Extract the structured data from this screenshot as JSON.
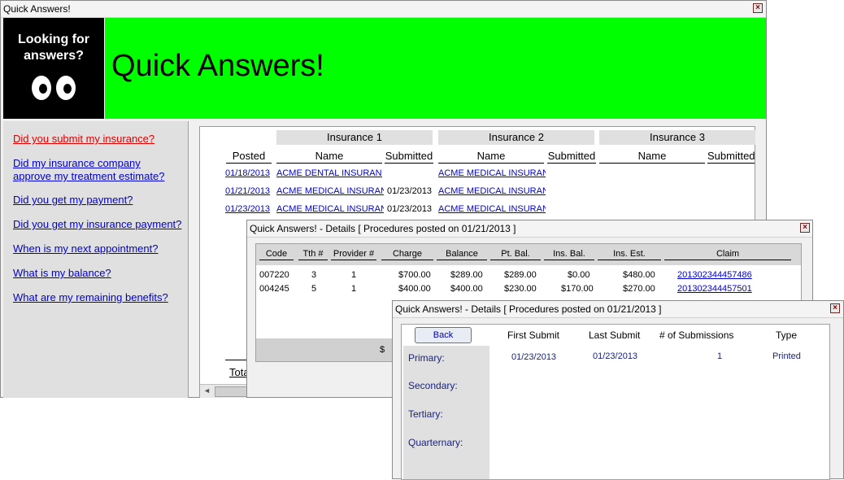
{
  "main": {
    "title": "Quick Answers!",
    "logo_line1": "Looking for",
    "logo_line2": "answers?",
    "banner_title": "Quick Answers!",
    "questions": [
      "Did you submit my insurance?",
      "Did my insurance company ",
      "approve my treatment estimate?",
      "Did you get my payment?",
      "Did you get my insurance payment?",
      "When is my next appointment?",
      "What is my balance?",
      "What are my remaining benefits?"
    ],
    "groups": [
      "Insurance 1",
      "Insurance 2",
      "Insurance 3"
    ],
    "col_posted": "Posted",
    "col_name": "Name",
    "col_submitted": "Submitted",
    "rows": [
      {
        "posted": "01/18/2013",
        "ins1": "ACME DENTAL INSURANCE",
        "sub1": "",
        "ins2": "ACME MEDICAL INSURANCE",
        "sub2": ""
      },
      {
        "posted": "01/21/2013",
        "ins1": "ACME MEDICAL INSURANCE",
        "sub1": "01/23/2013",
        "ins2": "ACME MEDICAL INSURANCE",
        "sub2": ""
      },
      {
        "posted": "01/23/2013",
        "ins1": "ACME MEDICAL INSURANCE",
        "sub1": "01/23/2013",
        "ins2": "ACME MEDICAL INSURANCE",
        "sub2": ""
      }
    ],
    "total_label": "Tota"
  },
  "details1": {
    "title": "Quick Answers! - Details [ Procedures posted on 01/21/2013 ]",
    "headers": [
      "Code",
      "Tth #",
      "Provider #",
      "Charge",
      "Balance",
      "Pt. Bal.",
      "Ins. Bal.",
      "Ins. Est.",
      "Claim"
    ],
    "rows": [
      [
        "007220",
        "3",
        "1",
        "$700.00",
        "$289.00",
        "$289.00",
        "$0.00",
        "$480.00",
        "201302344457486"
      ],
      [
        "004245",
        "5",
        "1",
        "$400.00",
        "$400.00",
        "$230.00",
        "$170.00",
        "$270.00",
        "201302344457501"
      ]
    ],
    "footer_fragment": "$"
  },
  "details2": {
    "title": "Quick Answers! - Details [ Procedures posted on 01/21/2013 ]",
    "back_label": "Back",
    "headers": [
      "First Submit",
      "Last Submit",
      "# of Submissions",
      "Type"
    ],
    "labels": [
      "Primary:",
      "Secondary:",
      "Tertiary:",
      "Quarternary:"
    ],
    "primary": {
      "first": "01/23/2013",
      "last": "01/23/2013",
      "count": "1",
      "type": "Printed"
    }
  },
  "colors": {
    "banner": "#00ff00",
    "link": "#0000cc",
    "selected_link": "#e00000",
    "label": "#1a237e"
  }
}
